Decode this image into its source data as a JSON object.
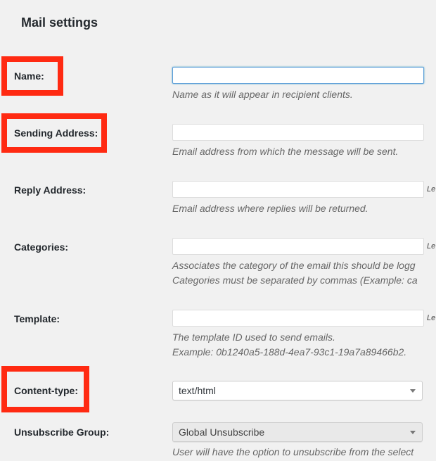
{
  "page": {
    "title": "Mail settings"
  },
  "fields": {
    "name": {
      "label": "Name:",
      "value": "",
      "description": "Name as it will appear in recipient clients."
    },
    "sending_address": {
      "label": "Sending Address:",
      "value": "",
      "description": "Email address from which the message will be sent."
    },
    "reply_address": {
      "label": "Reply Address:",
      "value": "",
      "aside": "Le",
      "description": "Email address where replies will be returned."
    },
    "categories": {
      "label": "Categories:",
      "value": "",
      "aside": "Le",
      "description_line1": "Associates the category of the email this should be logg",
      "description_line2": "Categories must be separated by commas (Example: ca"
    },
    "template": {
      "label": "Template:",
      "value": "",
      "aside": "Le",
      "description_line1": "The template ID used to send emails.",
      "description_line2": "Example: 0b1240a5-188d-4ea7-93c1-19a7a89466b2."
    },
    "content_type": {
      "label": "Content-type:",
      "selected": "text/html"
    },
    "unsubscribe_group": {
      "label": "Unsubscribe Group:",
      "selected": "Global Unsubscribe",
      "description": "User will have the option to unsubscribe from the select"
    }
  },
  "colors": {
    "highlight": "#ff2a12",
    "background": "#f1f1f1",
    "focus": "#5b9dd9"
  }
}
